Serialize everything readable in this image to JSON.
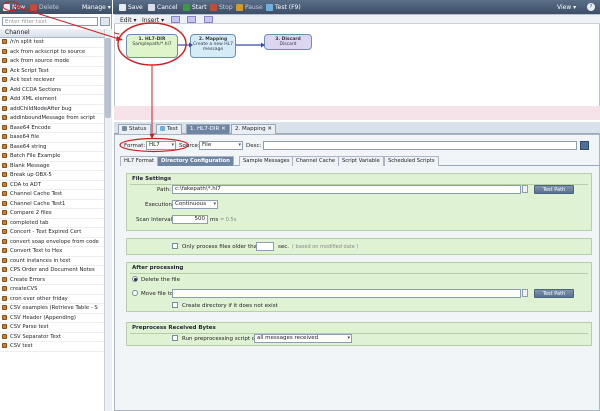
{
  "toolbar_left": {
    "new": "New",
    "delete": "Delete",
    "manage": "Manage"
  },
  "toolbar_main": {
    "save": "Save",
    "cancel": "Cancel",
    "start": "Start",
    "stop": "Stop",
    "pause": "Pause",
    "test": "Test (F9)",
    "view": "View"
  },
  "sidebar": {
    "filter_placeholder": "Enter filter text",
    "header": "Channel",
    "items": [
      "/r/n split test",
      "ack from ackscript to source",
      "ack from source mode",
      "Ack Script Test",
      "Ack text reciever",
      "Add CCDA Sections",
      "Add XML element",
      "addChildNodeAfter bug",
      "addinboundMessage from script",
      "Base64 Encode",
      "base64 file",
      "Base64 string",
      "Batch File Example",
      "Blank Message",
      "Break up OBX-5",
      "CDA to ADT",
      "Channel Cache Test",
      "Channel Cache Test1",
      "Compare 2 files",
      "completed tab",
      "Concert - Text Expired Cert",
      "convert soap envelope from code",
      "Convert Text to Hex",
      "count instances in text",
      "CPS Order and Document Notes",
      "Create Errors",
      "createCVS",
      "cron ever other friday",
      "CSV examples (Retrieve Table - S",
      "CSV Header (Appending)",
      "CSV Parse test",
      "CSV Separator Text",
      "CSV test"
    ]
  },
  "canvas": {
    "edit": "Edit",
    "insert": "Insert",
    "nodes": [
      {
        "title": "1. HL7-DIR",
        "sub": "Samplepath/*.hl7"
      },
      {
        "title": "2. Mapping",
        "sub": "Create a new HL7 message"
      },
      {
        "title": "3. Discard",
        "sub": "Discard"
      }
    ]
  },
  "tabs": [
    "Status",
    "Test",
    "1. HL7-DIR",
    "2. Mapping"
  ],
  "source": {
    "format_label": "Format:",
    "format_value": "HL7",
    "source_label": "Source:",
    "source_value": "File",
    "desc_label": "Desc:",
    "desc_value": ""
  },
  "subtabs": [
    "HL7 Format",
    "Directory Configuration",
    "Sample Messages",
    "Channel Cache",
    "Script Variable",
    "Scheduled Scripts"
  ],
  "file_settings": {
    "title": "File Settings",
    "path_label": "Path:",
    "path_value": "c:\\fakepath\\*.hl7",
    "test_path": "Test Path",
    "execution_label": "Execution:",
    "execution_value": "Continuous",
    "interval_label": "Scan Interval:",
    "interval_value": "500",
    "interval_unit": "ms",
    "interval_hint": "= 0.5s"
  },
  "older": {
    "label": "Only process files older than",
    "value": "",
    "unit": "sec.",
    "hint": "( based on modified date )"
  },
  "after": {
    "title": "After processing",
    "delete": "Delete the file",
    "move": "Move file to:",
    "move_value": "",
    "create_dir": "Create directory if it does not exist",
    "test_path": "Test Path"
  },
  "preprocess": {
    "title": "Preprocess Received Bytes",
    "label": "Run preprocessing script on",
    "value": "all messages received"
  }
}
